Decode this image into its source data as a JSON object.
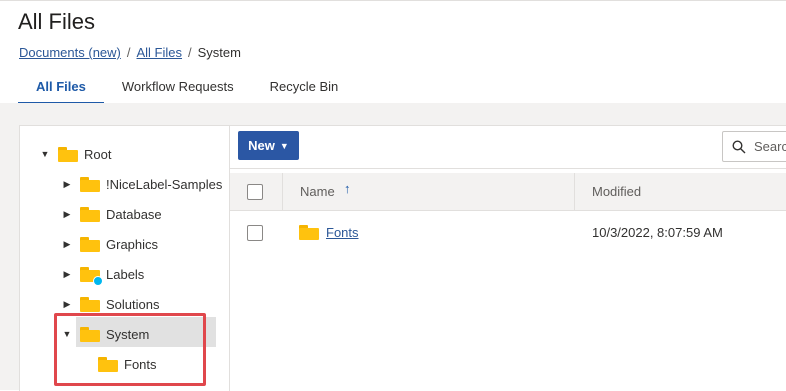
{
  "page": {
    "title": "All Files"
  },
  "breadcrumb": {
    "items": [
      "Documents (new)",
      "All Files",
      "System"
    ],
    "separator": "/"
  },
  "tabs": [
    {
      "label": "All Files",
      "active": true
    },
    {
      "label": "Workflow Requests",
      "active": false
    },
    {
      "label": "Recycle Bin",
      "active": false
    }
  ],
  "tree": {
    "root": {
      "label": "Root",
      "expanded": true
    },
    "items": [
      {
        "label": "!NiceLabel-Samples",
        "icon": "folder-icon"
      },
      {
        "label": "Database",
        "icon": "folder-icon"
      },
      {
        "label": "Graphics",
        "icon": "folder-icon"
      },
      {
        "label": "Labels",
        "icon": "folder-status-icon"
      },
      {
        "label": "Solutions",
        "icon": "folder-icon"
      },
      {
        "label": "System",
        "icon": "folder-icon",
        "expanded": true,
        "selected": true
      }
    ],
    "child": {
      "label": "Fonts",
      "icon": "folder-icon"
    }
  },
  "toolbar": {
    "new_label": "New",
    "search_placeholder": "Search"
  },
  "table": {
    "columns": [
      "Name",
      "Modified"
    ],
    "sort": {
      "column": "Name",
      "direction": "ascending"
    },
    "rows": [
      {
        "name": "Fonts",
        "modified": "10/3/2022, 8:07:59 AM",
        "type": "folder"
      }
    ]
  },
  "colors": {
    "accent": "#1e5aa8",
    "button": "#2b57a4",
    "folder": "#ffc20e",
    "highlight_box": "#e0474c",
    "status_dot": "#00b7ef"
  }
}
